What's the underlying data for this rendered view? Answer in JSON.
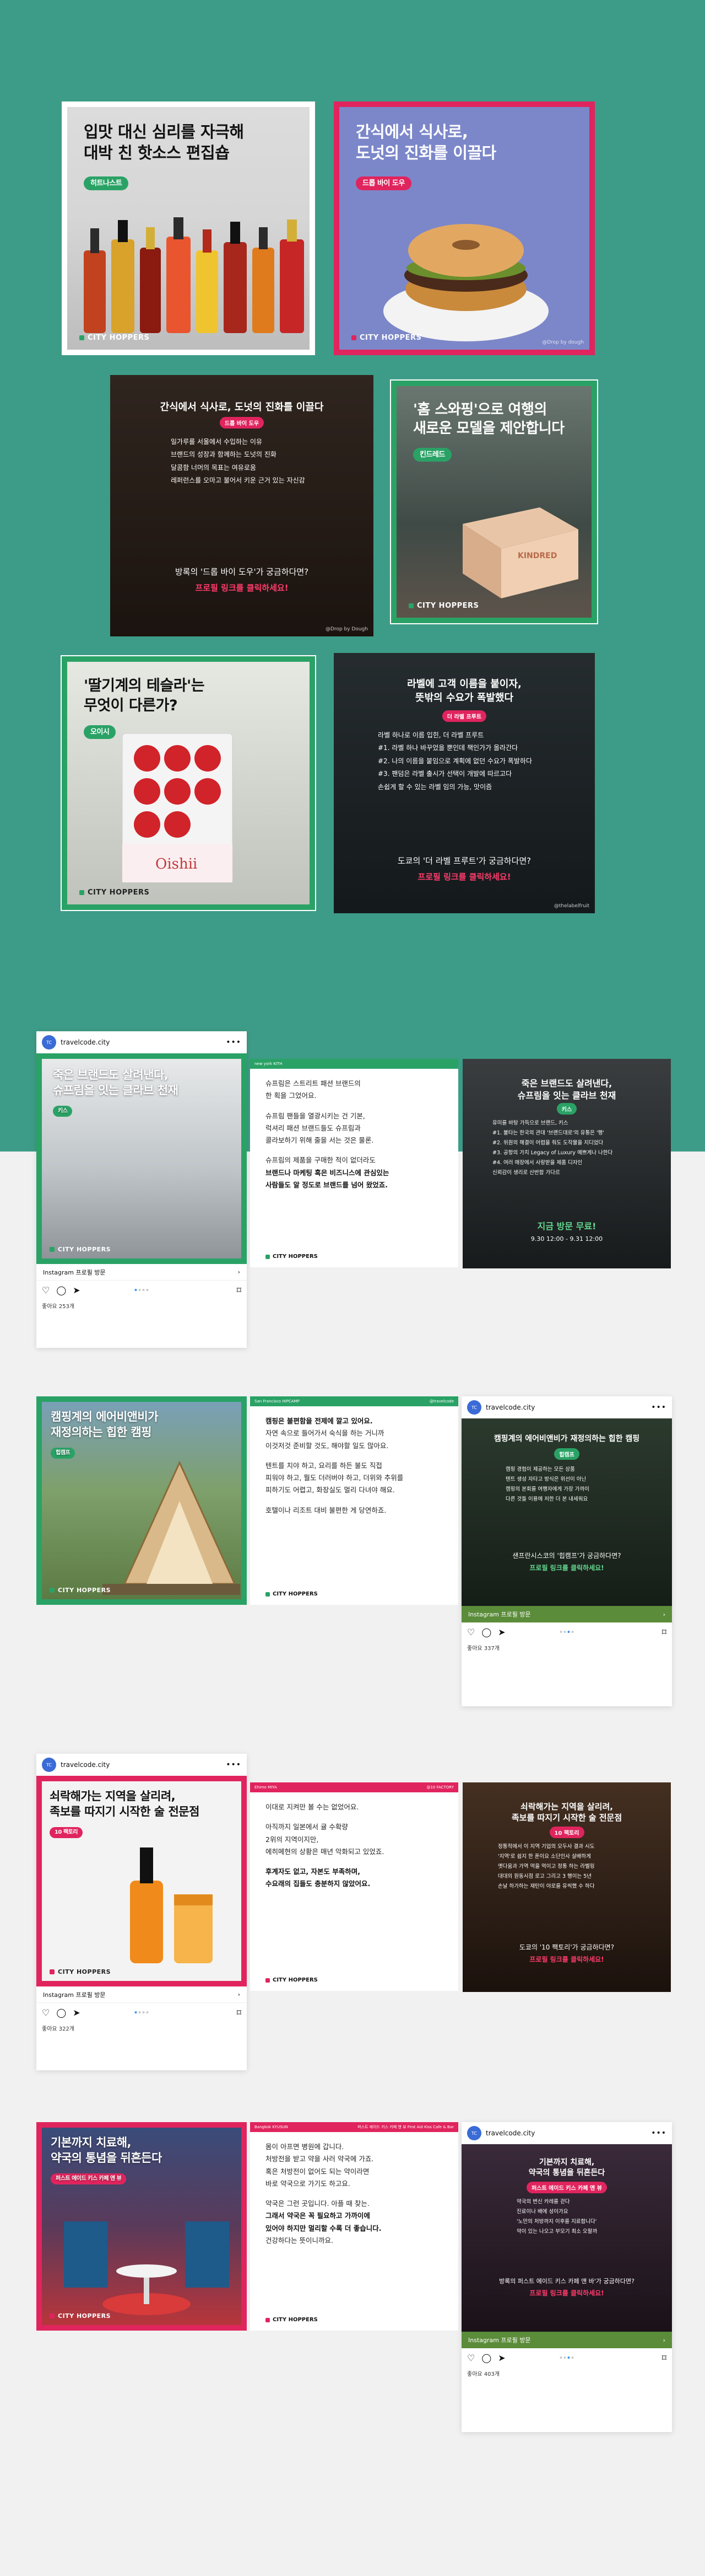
{
  "brand": "CITY HOPPERS",
  "colors": {
    "teal": "#3d9c87",
    "green": "#2aa266",
    "red": "#e0245e",
    "bg": "#f1f1f1"
  },
  "top_cards": {
    "c1": {
      "title_1": "입맛 대신 심리를 자극해",
      "title_2": "대박 친 핫소스 편집숍",
      "badge": "히트나스트"
    },
    "c2": {
      "title_1": "간식에서 식사로,",
      "title_2": "도넛의 진화를 이끌다",
      "badge": "드롭 바이 도우",
      "credit": "@Drop by dough"
    },
    "c3": {
      "title": "간식에서 식사로, 도넛의 진화를 이끌다",
      "badge": "드롭 바이 도우",
      "items": [
        "일가루를 서울에서 수입하는 이유",
        "브랜드의 성장과 함께하는 도넛의 진화",
        "달콤함 너머의 목표는 여유로움",
        "레퍼런스를 오마고 불어서 키운 근거 있는 자신감"
      ],
      "cta_q": "방록의 '드롭 바이 도우'가 궁금하다면?",
      "cta_r": "프로필 링크를 클릭하세요!",
      "credit": "@Drop by Dough"
    },
    "c4": {
      "title_1": "'홈 스와핑'으로 여행의",
      "title_2": "새로운 모델을 제안합니다",
      "badge": "킨드레드",
      "box_text": "KINDRED"
    },
    "c5": {
      "title_1": "'딸기계의 테슬라'는",
      "title_2": "무엇이 다른가?",
      "badge": "오이시",
      "box_text": "Oishii"
    },
    "c6": {
      "title_1": "라벨에 고객 이름을 붙이자,",
      "title_2": "뜻밖의 수요가 폭발했다",
      "badge": "더 라벨 프루트",
      "items": [
        "라벨 하나로 이름 입힌, 더 라벨 프루트",
        "#1. 라벨 하나 바꾸었을 뿐인데 책인가가 올라간다",
        "#2. 나의 이름을 붙임으로 계획에 없던 수요가 폭발하다",
        "#3. 팬덤은 라벨 출시가 선택이 개발에 따르고다",
        "손쉽게 할 수 있는 라벨 임의 가능, 맛이즘"
      ],
      "cta_q": "도쿄의 '더 라벨 프루트'가 궁금하다면?",
      "cta_r": "프로필 링크를 클릭하세요!",
      "credit": "@thelabelfruit"
    }
  },
  "ig": {
    "account": "travelcode.city",
    "profile_bar": "Instagram 프로필 방문",
    "more": "•••"
  },
  "row1": {
    "card": {
      "title_1": "죽은 브랜드도 살려낸다,",
      "title_2": "슈프림을 잇는 클라브 천재",
      "badge": "키스",
      "likes": "좋아요 253개"
    },
    "text": {
      "strip_l": "new york KITH",
      "strip_r": "",
      "p1": "슈프림은 스트리트 패션 브랜드의",
      "p1b": "한 획을 그었어요.",
      "p2": "슈프림 팬들을 열광시키는 건 기본,",
      "p2b": "럭셔리 패션 브랜드들도 슈프림과",
      "p2c": "콜라보하기 위해 줄을 서는 것은 물론.",
      "p3": "슈프림의 제품을 구매한 적이 없더라도",
      "p3b": "브랜드나 마케팅 혹은 비즈니스에 관심있는",
      "p3c": "사람들도 알 정도로 브랜드를 넘어 왔었죠."
    },
    "side": {
      "title_1": "죽은 브랜드도 살려낸다,",
      "title_2": "슈프림을 잇는 클라브 천재",
      "badge": "키스",
      "items": [
        "유미를 바탕 가득으로 브랜드, 키스",
        "#1. 불타는 한국의 관대 '브랜드대로'의 유통은 '행'",
        "#2. 위원의 해결이 어렵을 줘도 도작물을 지디었다",
        "#3. 공항의 가치 Legacy of Luxury 예쁘게나 나한다",
        "#4. 여러 매장에서 사랑받을 제품 디자인",
        "신뢰감이 생리로 산반합 가다르"
      ],
      "cta_q": "지금 방문 무료!",
      "cta_r": "9.30 12:00 - 9.31 12:00"
    }
  },
  "row2": {
    "card": {
      "title_1": "캠핑계의 에어비앤비가",
      "title_2": "재정의하는 힙한 캠핑",
      "badge": "힙캠프"
    },
    "text": {
      "strip_l": "San Francisco HIPCAMP",
      "strip_r": "@travelcode",
      "p1": "캠핑은 불편함을 전제에 깔고 있어요.",
      "p1b": "자연 속으로 들어가서 숙식을 하는 거니까",
      "p1c": "이것저것 준비할 것도, 해야할 일도 많아요.",
      "p2": "텐트를 치야 하고, 요리를 하든 불도 직접",
      "p2b": "피워야 하고, 뭘도 더러버야 하고, 더위와 추위를",
      "p2c": "피하기도 어렵고, 화장실도 멀리 다녀야 해요.",
      "p3": "호텔이나 리조트 대비 불편한 게 당연하죠."
    },
    "side": {
      "title": "캠핑계의 에어비앤비가 재정의하는 힙한 캠핑",
      "badge": "힙캠프",
      "items": [
        "캠핑 경험이 제공하는 모든 상품",
        "텐트 생성 자타고 방식은 위선이 아닌",
        "캠핑의 본회를 여행자에게 가장 가까이",
        "다른 것들 이용에 저한 더 본 내세워요"
      ],
      "cta_q": "샌프란시스코의 '힙캠프'가 궁금하다면?",
      "cta_r": "프로필 링크를 클릭하세요!",
      "likes": "좋아요 337개"
    }
  },
  "row3": {
    "card": {
      "title_1": "쇠락해가는 지역을 살리려,",
      "title_2": "족보를 따지기 시작한 술 전문점",
      "badge": "10 팩토리",
      "likes": "좋아요 322개"
    },
    "text": {
      "strip_l": "Ehime MIYA",
      "strip_r": "@10 FACTORY",
      "p1": "이대로 지켜만 볼 수는 없었어요.",
      "p2": "아직까지 일본에서 귤 수확량",
      "p2b": "2위의 지역이지만,",
      "p2c": "에히메현의 상황은 매년 악화되고 있었죠.",
      "p3": "후계자도 없고, 자본도 부족하며,",
      "p3b": "수요래의 집들도 충분하지 않았어요."
    },
    "side": {
      "title_1": "쇠락해가는 지역을 살리려,",
      "title_2": "족보를 따지기 시작한 술 전문점",
      "badge": "10 팩토리",
      "items": [
        "정통적에서 이 지역 기업의 모두사 결과 시도",
        "'지역'로 쉽지 한 푼이요 소단인사 살배하게",
        "옛다움과 가역 먹을 먹이고 정통 하는 라벨링",
        "대대의 원동시점 로고 그리고 3 행이는 5년",
        "손날 하가하는 재탄이 야로를 유씩했 수 하다"
      ],
      "cta_q": "도쿄의 '10 팩토리'가 궁금하다면?",
      "cta_r": "프로필 링크를 클릭하세요!"
    }
  },
  "row4": {
    "card": {
      "title_1": "기본까지 치료해,",
      "title_2": "약국의 통념을 뒤흔든다",
      "badge": "퍼스트 에이드 키스 카페 앤 뷰"
    },
    "text": {
      "strip_l": "Bangkok KYUSUN",
      "strip_r": "퍼스트 에이드 키스 카페 앤 뷰 First Aid Kiss Cafe & Bar",
      "p1": "몸이 아프면 병원에 갑니다.",
      "p1b": "처방전을 받고 약을 사러 약국에 가죠.",
      "p1c": "혹은 처방전이 없어도 되는 약이라면",
      "p1d": "바로 약국으로 가기도 하고요.",
      "p2": "약국은 그런 곳입니다. 아플 때 찾는.",
      "p2b": "그래서 약국은 꼭 필요하고 가까이에",
      "p2c": "있어야 하지만 멀리할 수록 더 좋습니다.",
      "p2d": "건강하다는 뜻이니까요."
    },
    "side": {
      "title_1": "기본까지 치료해,",
      "title_2": "약국의 통념을 뒤흔든다",
      "badge": "퍼스트 에이드 키스 카페 앤 뷰",
      "items": [
        "약국의 변신 카레를 걷다",
        "진료이나 배에 성이가요",
        "'노만의 처방까지 이후를 지료합니다'",
        "약이 있는 나오고 부모기 최소 오팔까"
      ],
      "cta_q": "방록의 퍼스트 에이드 키스 카페 앤 바'가 궁금하다면?",
      "cta_r": "프로필 링크를 클릭하세요!",
      "likes": "좋아요 403개"
    }
  }
}
